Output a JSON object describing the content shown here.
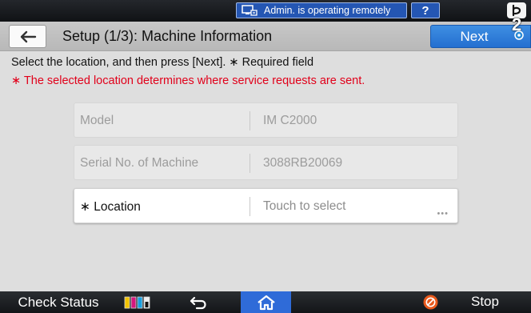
{
  "status_bar": {
    "remote_text": "Admin. is operating remotely",
    "help_label": "?"
  },
  "title_bar": {
    "title": "Setup (1/3): Machine Information",
    "next_label": "Next",
    "badge_number": "2"
  },
  "instructions": {
    "main": "Select the location, and then press [Next]. ∗ Required field",
    "warning": "∗ The selected location determines where service requests are sent."
  },
  "fields": [
    {
      "label": "Model",
      "value": "IM C2000"
    },
    {
      "label": "Serial No. of Machine",
      "value": "3088RB20069"
    },
    {
      "label": "∗ Location",
      "value": "Touch to select",
      "more": "•••"
    }
  ],
  "bottom_bar": {
    "check_status_label": "Check Status",
    "stop_label": "Stop"
  },
  "colors": {
    "accent_blue": "#246fd0",
    "warning_red": "#e1001a",
    "stop_orange": "#e8591c",
    "home_blue": "#2f6bd8"
  },
  "icons": [
    "remote-monitor-icon",
    "function-switch-icon",
    "back-arrow-icon",
    "gear-icon",
    "toner-icon",
    "undo-arrow-icon",
    "home-icon",
    "stop-icon"
  ]
}
